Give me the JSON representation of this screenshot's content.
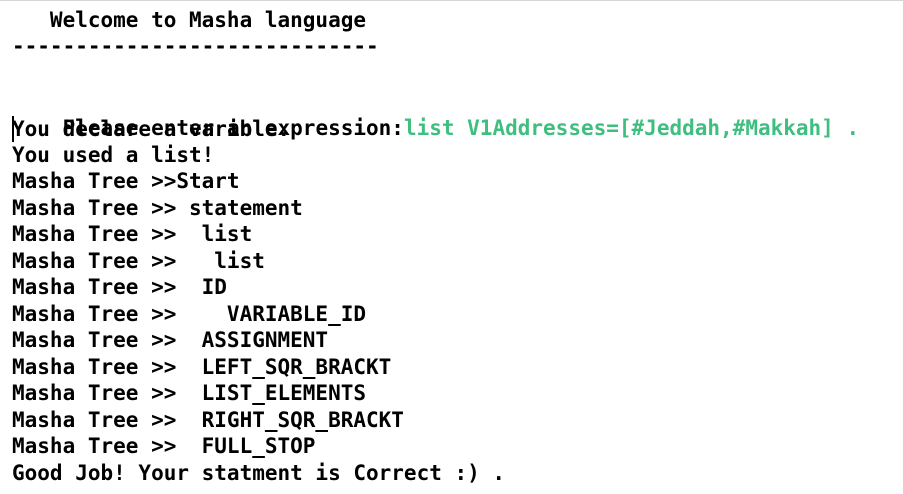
{
  "terminal": {
    "header": "   Welcome to Masha language",
    "separator": "-----------------------------",
    "prompt_label": "Please enter an expression:",
    "input_echo": "list V1Addresses=[#Jeddah,#Makkah] .",
    "output_lines": [
      "You declare a varible.",
      "You used a list!",
      "Masha Tree >>Start",
      "Masha Tree >> statement",
      "Masha Tree >>  list",
      "Masha Tree >>   list",
      "Masha Tree >>  ID",
      "Masha Tree >>    VARIABLE_ID",
      "Masha Tree >>  ASSIGNMENT",
      "Masha Tree >>  LEFT_SQR_BRACKT",
      "Masha Tree >>  LIST_ELEMENTS",
      "Masha Tree >>  RIGHT_SQR_BRACKT",
      "Masha Tree >>  FULL_STOP",
      "Good Job! Your statment is Correct :) ."
    ]
  }
}
